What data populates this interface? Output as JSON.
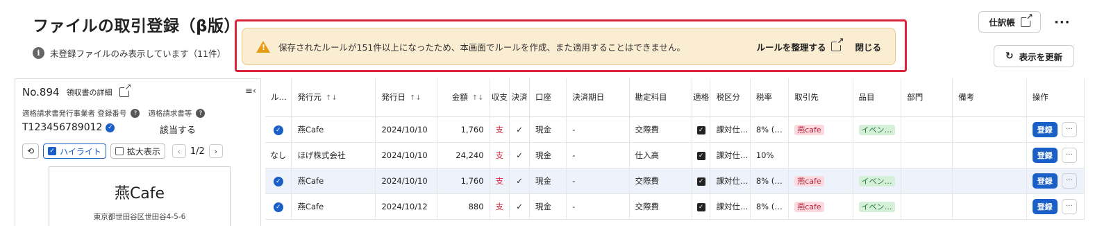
{
  "header": {
    "title": "ファイルの取引登録（β版）",
    "info_text": "未登録ファイルのみ表示しています（11件）",
    "journal_label": "仕訳帳",
    "more_label": "···",
    "refresh_label": "表示を更新"
  },
  "alert": {
    "message": "保存されたルールが151件以上になったため、本画面でルールを作成、また適用することはできません。",
    "link_label": "ルールを整理する",
    "close_label": "閉じる",
    "border_color": "#d9243a",
    "bg_color": "#fbedd2"
  },
  "left_panel": {
    "number": "No.894",
    "detail_label": "領収書の詳細",
    "reg_label": "適格請求書発行事業者 登録番号",
    "qualified_label": "適格請求書等",
    "reg_number": "T123456789012",
    "qualified_value": "該当する",
    "highlight_label": "ハイライト",
    "zoom_label": "拡大表示",
    "page": "1/2",
    "receipt_name": "燕Cafe",
    "receipt_address": "東京都世田谷区世田谷4-5-6"
  },
  "table": {
    "headers": {
      "rule": "ル…",
      "issuer": "発行元",
      "date": "発行日",
      "amount": "金額",
      "inout": "収支",
      "settled": "決済",
      "account": "口座",
      "due": "決済期日",
      "subject": "勘定科目",
      "qualified": "適格",
      "tax_class": "税区分",
      "tax_rate": "税率",
      "partner": "取引先",
      "item": "品目",
      "dept": "部門",
      "memo": "備考",
      "ops": "操作"
    },
    "rows": [
      {
        "rule": "",
        "rule_ok": true,
        "issuer": "燕Cafe",
        "date": "2024/10/10",
        "amount": "1,760",
        "inout": "支",
        "settled": "✓",
        "account": "現金",
        "due": "-",
        "subject": "交際費",
        "tax_class": "課対仕…",
        "tax_rate": "8% (…",
        "partner": "燕cafe",
        "item": "イベン…",
        "register": "登録"
      },
      {
        "rule": "なし",
        "rule_ok": false,
        "issuer": "ほげ株式会社",
        "date": "2024/10/10",
        "amount": "24,240",
        "inout": "支",
        "settled": "✓",
        "account": "現金",
        "due": "-",
        "subject": "仕入高",
        "tax_class": "課対仕…",
        "tax_rate": "10%",
        "partner": "",
        "item": "",
        "register": "登録"
      },
      {
        "rule": "",
        "rule_ok": true,
        "issuer": "燕Cafe",
        "date": "2024/10/10",
        "amount": "1,760",
        "inout": "支",
        "settled": "✓",
        "account": "現金",
        "due": "-",
        "subject": "交際費",
        "tax_class": "課対仕…",
        "tax_rate": "8% (…",
        "partner": "燕cafe",
        "item": "イベン…",
        "register": "登録"
      },
      {
        "rule": "",
        "rule_ok": true,
        "issuer": "燕Cafe",
        "date": "2024/10/12",
        "amount": "880",
        "inout": "支",
        "settled": "✓",
        "account": "現金",
        "due": "-",
        "subject": "交際費",
        "tax_class": "課対仕…",
        "tax_rate": "8% (…",
        "partner": "燕cafe",
        "item": "イベン…",
        "register": "登録"
      }
    ]
  }
}
